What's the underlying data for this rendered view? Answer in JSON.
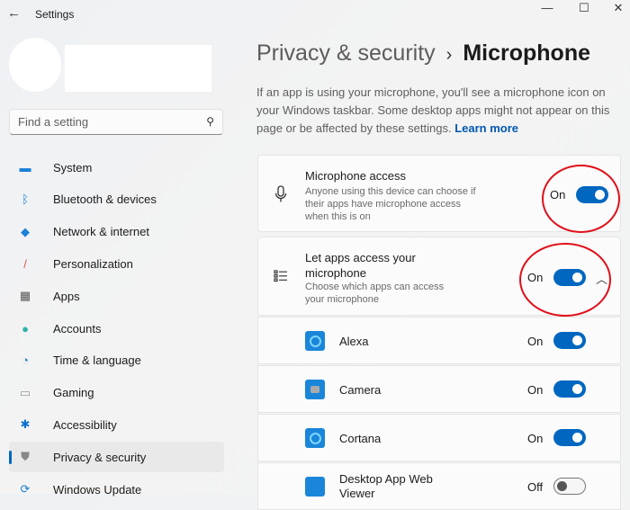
{
  "window": {
    "title": "Settings",
    "back_icon": "←",
    "minimize": "—",
    "maximize": "☐",
    "close": "✕"
  },
  "search": {
    "placeholder": "Find a setting",
    "icon": "⚲"
  },
  "sidebar": {
    "items": [
      {
        "label": "System",
        "icon": "▬",
        "color": "#1a7fd6"
      },
      {
        "label": "Bluetooth & devices",
        "icon": "ᛒ",
        "color": "#1a7fd6"
      },
      {
        "label": "Network & internet",
        "icon": "◆",
        "color": "#1a7fd6"
      },
      {
        "label": "Personalization",
        "icon": "/",
        "color": "#e0524d"
      },
      {
        "label": "Apps",
        "icon": "▦",
        "color": "#555"
      },
      {
        "label": "Accounts",
        "icon": "●",
        "color": "#2fb3a8"
      },
      {
        "label": "Time & language",
        "icon": "◔",
        "color": "#1a7fd6"
      },
      {
        "label": "Gaming",
        "icon": "▭",
        "color": "#999"
      },
      {
        "label": "Accessibility",
        "icon": "✱",
        "color": "#0a6fd0"
      },
      {
        "label": "Privacy & security",
        "icon": "⛊",
        "color": "#888"
      },
      {
        "label": "Windows Update",
        "icon": "⟳",
        "color": "#1a7fd6"
      }
    ],
    "selected": 9
  },
  "header": {
    "parent": "Privacy & security",
    "separator": "›",
    "current": "Microphone"
  },
  "description": {
    "text": "If an app is using your microphone, you'll see a microphone icon on your Windows taskbar. Some desktop apps might not appear on this page or be affected by these settings.",
    "link": "Learn more"
  },
  "mic_access": {
    "title": "Microphone access",
    "subtitle": "Anyone using this device can choose if their apps have microphone access when this is on",
    "state": "On",
    "on": true
  },
  "apps_access": {
    "title": "Let apps access your microphone",
    "subtitle": "Choose which apps can access your microphone",
    "state": "On",
    "on": true,
    "expanded": true
  },
  "apps": [
    {
      "name": "Alexa",
      "state": "On",
      "on": true
    },
    {
      "name": "Camera",
      "state": "On",
      "on": true
    },
    {
      "name": "Cortana",
      "state": "On",
      "on": true
    },
    {
      "name": "Desktop App Web Viewer",
      "state": "Off",
      "on": false
    }
  ],
  "colors": {
    "accent": "#0067c0",
    "annotation": "#e0101a"
  }
}
